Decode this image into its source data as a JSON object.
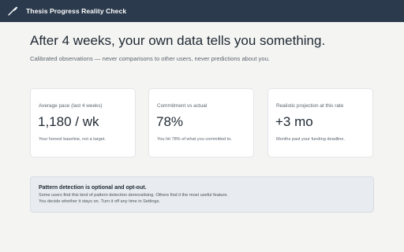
{
  "titlebar": {
    "icon": "quill-icon",
    "title": "Thesis Progress Reality Check"
  },
  "main": {
    "headline": "After 4 weeks, your own data tells you something.",
    "subline": "Calibrated observations — never comparisons to other users, never predictions about you."
  },
  "cards": [
    {
      "label": "Average pace (last 4 weeks)",
      "value": "1,180 / wk",
      "note": "Your honest baseline, not a target."
    },
    {
      "label": "Commitment vs actual",
      "value": "78%",
      "note": "You hit 78% of what you committed to."
    },
    {
      "label": "Realistic projection at this rate",
      "value": "+3 mo",
      "note": "Months past your funding deadline."
    }
  ],
  "notice": {
    "title": "Pattern detection is optional and opt-out.",
    "line1": "Some users find this kind of pattern detection demoralising. Others find it the most useful feature.",
    "line2": "You decide whether it stays on. Turn it off any time in Settings."
  },
  "colors": {
    "titlebar": "#2b3a4c",
    "background": "#f4f4f2",
    "card": "#ffffff",
    "notice": "#e8ecf0"
  }
}
